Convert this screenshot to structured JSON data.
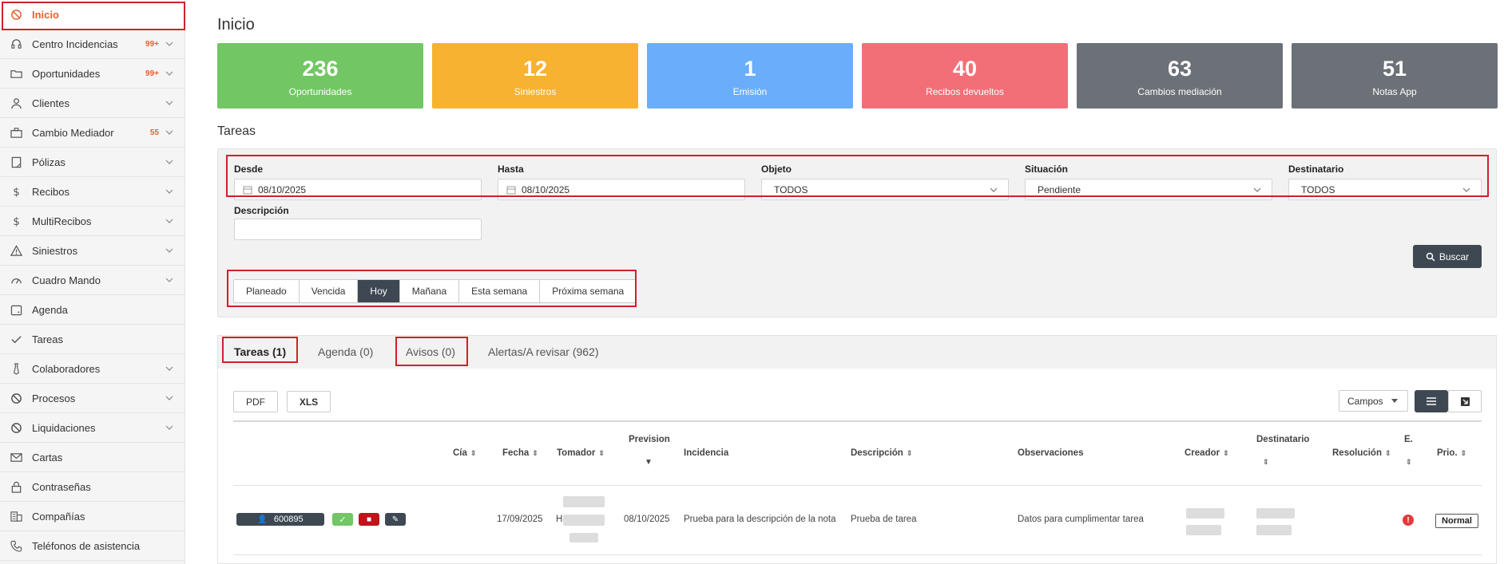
{
  "sidebar": {
    "items": [
      {
        "label": "Inicio",
        "icon": "circle-slash-icon",
        "badge": "",
        "active": true,
        "chevron": false
      },
      {
        "label": "Centro Incidencias",
        "icon": "headset-icon",
        "badge": "99+",
        "chevron": true
      },
      {
        "label": "Oportunidades",
        "icon": "folder-icon",
        "badge": "99+",
        "chevron": true
      },
      {
        "label": "Clientes",
        "icon": "user-icon",
        "badge": "",
        "chevron": true
      },
      {
        "label": "Cambio Mediador",
        "icon": "briefcase-icon",
        "badge": "55",
        "chevron": true
      },
      {
        "label": "Pólizas",
        "icon": "document-icon",
        "badge": "",
        "chevron": true
      },
      {
        "label": "Recibos",
        "icon": "dollar-icon",
        "badge": "",
        "chevron": true
      },
      {
        "label": "MultiRecibos",
        "icon": "dollar-icon",
        "badge": "",
        "chevron": true
      },
      {
        "label": "Siniestros",
        "icon": "warning-icon",
        "badge": "",
        "chevron": true
      },
      {
        "label": "Cuadro Mando",
        "icon": "gauge-icon",
        "badge": "",
        "chevron": true
      },
      {
        "label": "Agenda",
        "icon": "calendar-icon",
        "badge": "",
        "chevron": false
      },
      {
        "label": "Tareas",
        "icon": "check-icon",
        "badge": "",
        "chevron": false
      },
      {
        "label": "Colaboradores",
        "icon": "tie-icon",
        "badge": "",
        "chevron": true
      },
      {
        "label": "Procesos",
        "icon": "circle-slash-icon",
        "badge": "",
        "chevron": true
      },
      {
        "label": "Liquidaciones",
        "icon": "circle-slash-icon",
        "badge": "",
        "chevron": true
      },
      {
        "label": "Cartas",
        "icon": "envelope-icon",
        "badge": "",
        "chevron": false
      },
      {
        "label": "Contraseñas",
        "icon": "lock-icon",
        "badge": "",
        "chevron": false
      },
      {
        "label": "Compañías",
        "icon": "building-icon",
        "badge": "",
        "chevron": false
      },
      {
        "label": "Teléfonos de asistencia",
        "icon": "phone-icon",
        "badge": "",
        "chevron": false
      }
    ]
  },
  "page": {
    "title": "Inicio",
    "section": "Tareas"
  },
  "cards": [
    {
      "value": "236",
      "label": "Oportunidades",
      "color": "#72c664"
    },
    {
      "value": "12",
      "label": "Siniestros",
      "color": "#f7b230"
    },
    {
      "value": "1",
      "label": "Emisión",
      "color": "#6aaefb"
    },
    {
      "value": "40",
      "label": "Recibos devueltos",
      "color": "#f36f78"
    },
    {
      "value": "63",
      "label": "Cambios mediación",
      "color": "#6c7178"
    },
    {
      "value": "51",
      "label": "Notas App",
      "color": "#6c7178"
    }
  ],
  "filters": {
    "desde_label": "Desde",
    "desde_value": "08/10/2025",
    "hasta_label": "Hasta",
    "hasta_value": "08/10/2025",
    "objeto_label": "Objeto",
    "objeto_value": "TODOS",
    "situacion_label": "Situación",
    "situacion_value": "Pendiente",
    "destinatario_label": "Destinatario",
    "destinatario_value": "TODOS",
    "descripcion_label": "Descripción",
    "descripcion_value": "",
    "buscar_label": "Buscar"
  },
  "periods": [
    {
      "label": "Planeado",
      "active": false
    },
    {
      "label": "Vencida",
      "active": false
    },
    {
      "label": "Hoy",
      "active": true
    },
    {
      "label": "Mañana",
      "active": false
    },
    {
      "label": "Esta semana",
      "active": false
    },
    {
      "label": "Próxima semana",
      "active": false
    }
  ],
  "tabs": [
    {
      "label": "Tareas (1)",
      "active": true
    },
    {
      "label": "Agenda (0)",
      "active": false
    },
    {
      "label": "Avisos (0)",
      "active": false
    },
    {
      "label": "Alertas/A revisar (962)",
      "active": false
    }
  ],
  "toolbar": {
    "pdf_label": "PDF",
    "xls_label": "XLS",
    "campos_label": "Campos"
  },
  "table": {
    "headers": {
      "cia": "Cía",
      "fecha": "Fecha",
      "tomador": "Tomador",
      "prevision": "Prevision",
      "incidencia": "Incidencia",
      "descripcion": "Descripción",
      "observaciones": "Observaciones",
      "creador": "Creador",
      "destinatario": "Destinatario",
      "resolucion": "Resolución",
      "estado": "E.",
      "prioridad": "Prio."
    },
    "rows": [
      {
        "id": "600895",
        "fecha": "17/09/2025",
        "tomador_initial": "H",
        "prevision": "08/10/2025",
        "incidencia": "Prueba para la descripción de la nota",
        "descripcion": "Prueba de tarea",
        "observaciones": "Datos para cumplimentar tarea",
        "prioridad": "Normal"
      }
    ]
  }
}
